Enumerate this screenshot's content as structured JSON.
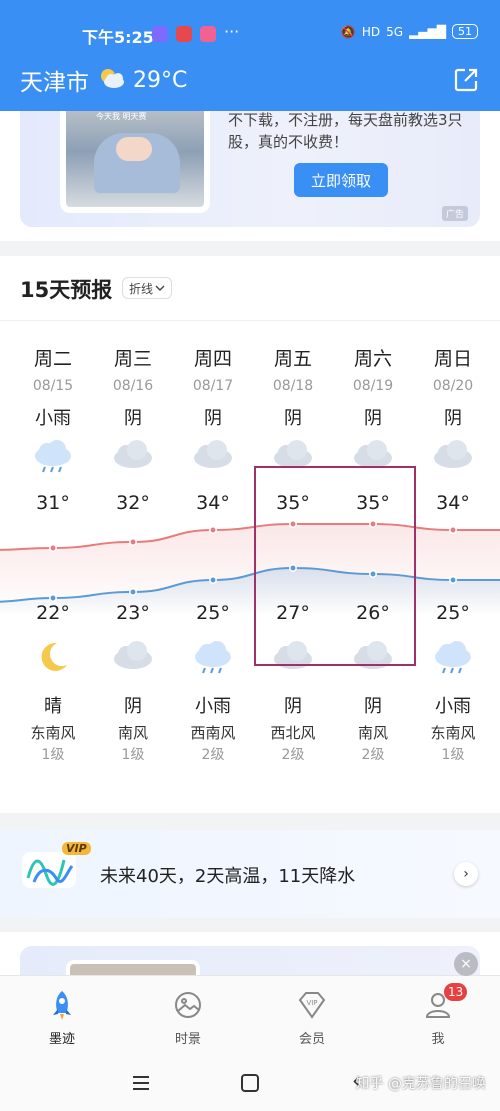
{
  "status": {
    "time": "下午5:25",
    "dots": "···",
    "network": "5G",
    "hd": "HD",
    "battery": "51"
  },
  "header": {
    "city": "天津市",
    "weather_icon": "partly-cloudy-icon",
    "temperature": "29°C",
    "share_icon": "share-icon"
  },
  "ad": {
    "text": "不下载，不注册，每天盘前教选3只股，真的不收费！",
    "button": "立即领取",
    "tag": "广告",
    "photo_caption": "今天我 明天赛"
  },
  "forecast": {
    "title": "15天预报",
    "mode": "折线",
    "days": [
      {
        "weekday": "周二",
        "date": "08/15",
        "day_cond": "小雨",
        "day_icon": "rain-cloud-icon",
        "high": "31°",
        "low": "22°",
        "night_icon": "moon-icon",
        "night_cond": "晴",
        "wind_dir": "东南风",
        "wind_level": "1级"
      },
      {
        "weekday": "周三",
        "date": "08/16",
        "day_cond": "阴",
        "day_icon": "overcast-cloud-icon",
        "high": "32°",
        "low": "23°",
        "night_icon": "overcast-cloud-icon",
        "night_cond": "阴",
        "wind_dir": "南风",
        "wind_level": "1级"
      },
      {
        "weekday": "周四",
        "date": "08/17",
        "day_cond": "阴",
        "day_icon": "overcast-cloud-icon",
        "high": "34°",
        "low": "25°",
        "night_icon": "rain-cloud-icon",
        "night_cond": "小雨",
        "wind_dir": "西南风",
        "wind_level": "2级"
      },
      {
        "weekday": "周五",
        "date": "08/18",
        "day_cond": "阴",
        "day_icon": "overcast-cloud-icon",
        "high": "35°",
        "low": "27°",
        "night_icon": "overcast-cloud-icon",
        "night_cond": "阴",
        "wind_dir": "西北风",
        "wind_level": "2级"
      },
      {
        "weekday": "周六",
        "date": "08/19",
        "day_cond": "阴",
        "day_icon": "overcast-cloud-icon",
        "high": "35°",
        "low": "26°",
        "night_icon": "overcast-cloud-icon",
        "night_cond": "阴",
        "wind_dir": "南风",
        "wind_level": "2级"
      },
      {
        "weekday": "周日",
        "date": "08/20",
        "day_cond": "阴",
        "day_icon": "overcast-cloud-icon",
        "high": "34°",
        "low": "25°",
        "night_icon": "rain-cloud-icon",
        "night_cond": "小雨",
        "wind_dir": "东南风",
        "wind_level": "1级"
      }
    ],
    "high_color": "#e87b7b",
    "low_color": "#5b9bd5",
    "highlight_color": "#a0306a"
  },
  "chart_data": {
    "type": "line",
    "categories": [
      "08/15",
      "08/16",
      "08/17",
      "08/18",
      "08/19",
      "08/20"
    ],
    "series": [
      {
        "values": [
          31,
          32,
          34,
          35,
          35,
          34
        ]
      },
      {
        "values": [
          22,
          23,
          25,
          27,
          26,
          25
        ]
      }
    ]
  },
  "vip": {
    "badge": "VIP",
    "text": "未来40天，2天高温，11天降水",
    "arrow": "›"
  },
  "ad2": {
    "close": "×"
  },
  "nav": {
    "items": [
      {
        "label": "墨迹",
        "icon": "rocket-icon"
      },
      {
        "label": "时景",
        "icon": "photo-icon"
      },
      {
        "label": "会员",
        "icon": "vip-diamond-icon"
      },
      {
        "label": "我",
        "icon": "profile-icon"
      }
    ],
    "badge": "13"
  },
  "sysbar": {
    "watermark": "知乎 @克苏鲁的召唤"
  }
}
